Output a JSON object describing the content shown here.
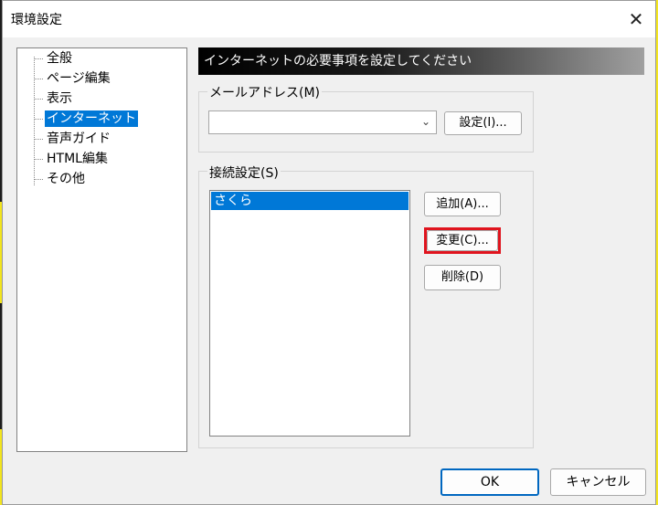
{
  "window": {
    "title": "環境設定"
  },
  "tree": {
    "items": [
      {
        "label": "全般",
        "selected": false
      },
      {
        "label": "ページ編集",
        "selected": false
      },
      {
        "label": "表示",
        "selected": false
      },
      {
        "label": "インターネット",
        "selected": true
      },
      {
        "label": "音声ガイド",
        "selected": false
      },
      {
        "label": "HTML編集",
        "selected": false
      },
      {
        "label": "その他",
        "selected": false
      }
    ]
  },
  "banner": {
    "text": "インターネットの必要事項を設定してください"
  },
  "mail": {
    "group_label": "メールアドレス(M)",
    "value": "",
    "settings_button": "設定(I)..."
  },
  "connection": {
    "group_label": "接続設定(S)",
    "entries": [
      "さくら"
    ],
    "add_button": "追加(A)...",
    "change_button": "変更(C)...",
    "delete_button": "削除(D)"
  },
  "footer": {
    "ok_label": "OK",
    "cancel_label": "キャンセル"
  },
  "colors": {
    "selection": "#0078d7",
    "highlight_frame": "#e0141e",
    "ok_border": "#0067c0"
  }
}
